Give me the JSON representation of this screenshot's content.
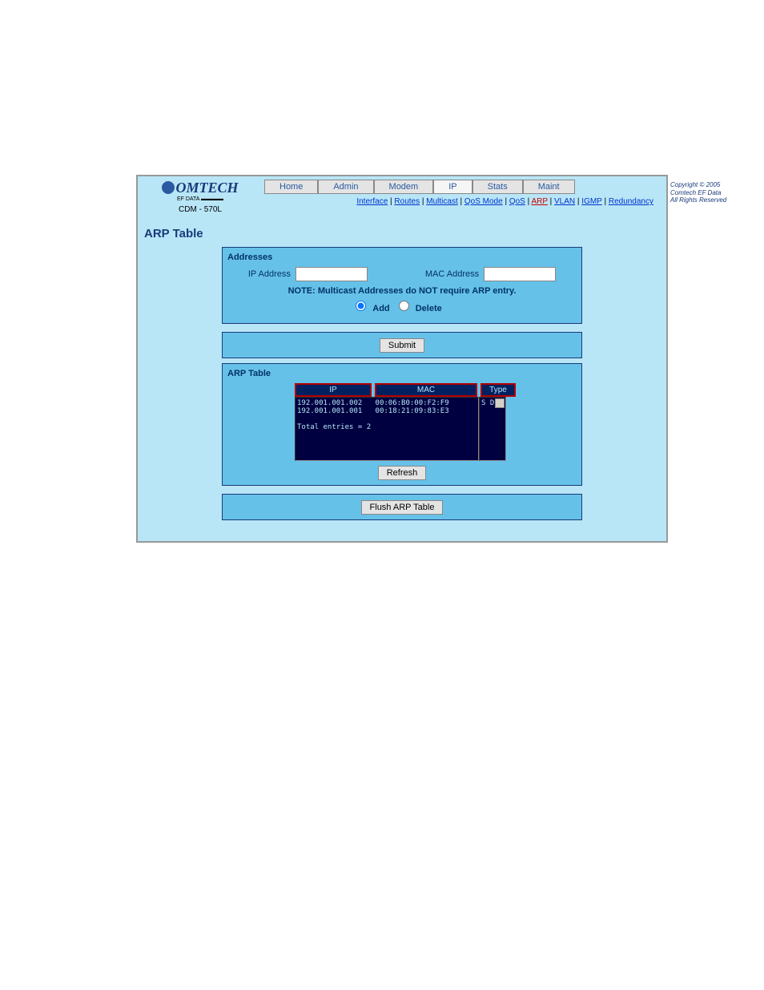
{
  "logo": {
    "brand": "OMTECH",
    "tag": "EF DATA ▬▬▬▬",
    "model": "CDM - 570L"
  },
  "copyright": [
    "Copyright © 2005",
    "Comtech EF Data",
    "All Rights Reserved"
  ],
  "tabs": [
    "Home",
    "Admin",
    "Modem",
    "IP",
    "Stats",
    "Maint"
  ],
  "active_tab": "IP",
  "subnav": [
    "Interface",
    "Routes",
    "Multicast",
    "QoS Mode",
    "QoS",
    "ARP",
    "VLAN",
    "IGMP",
    "Redundancy"
  ],
  "active_subnav": "ARP",
  "page_title": "ARP Table",
  "addresses": {
    "title": "Addresses",
    "ip_label": "IP Address",
    "mac_label": "MAC Address",
    "note": "NOTE: Multicast Addresses do NOT require ARP entry.",
    "add_label": "Add",
    "delete_label": "Delete"
  },
  "buttons": {
    "submit": "Submit",
    "refresh": "Refresh",
    "flush": "Flush ARP Table"
  },
  "arp": {
    "title": "ARP Table",
    "headers": {
      "ip": "IP",
      "mac": "MAC",
      "type": "Type"
    },
    "listing": "192.001.001.002   00:06:B0:00:F2:F9\n192.001.001.001   00:18:21:09:83:E3\n\nTotal entries = 2",
    "types": "S\nD"
  }
}
